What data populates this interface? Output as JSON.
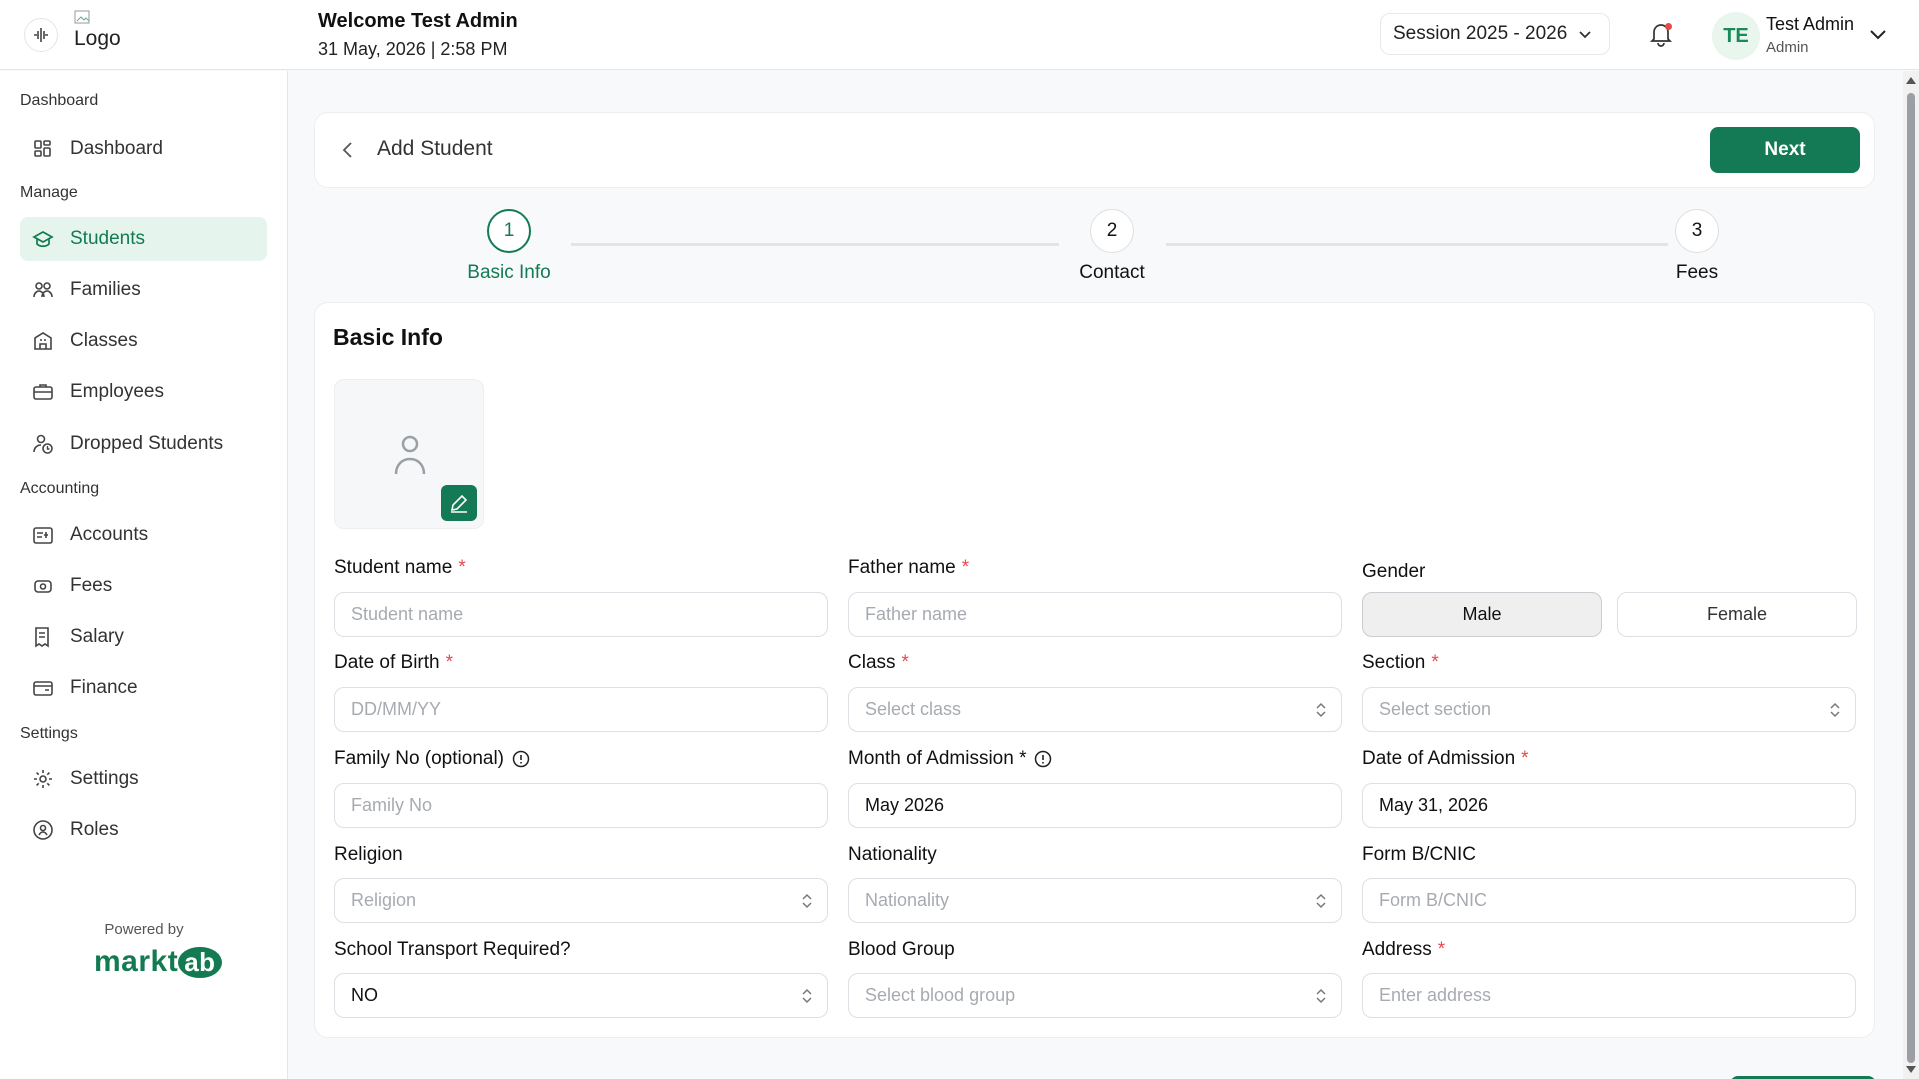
{
  "header": {
    "logo_alt": "Logo",
    "welcome": "Welcome Test Admin",
    "datetime": "31 May, 2026 | 2:58 PM",
    "session": "Session 2025 - 2026",
    "user_initials": "TE",
    "user_name": "Test Admin",
    "user_role": "Admin"
  },
  "sidebar": {
    "sections": [
      "Dashboard",
      "Manage",
      "Accounting",
      "Settings"
    ],
    "items": [
      {
        "label": "Dashboard",
        "icon": "grid-icon"
      },
      {
        "label": "Students",
        "icon": "graduation-cap-icon",
        "active": true
      },
      {
        "label": "Families",
        "icon": "users-icon"
      },
      {
        "label": "Classes",
        "icon": "building-icon"
      },
      {
        "label": "Employees",
        "icon": "briefcase-icon"
      },
      {
        "label": "Dropped Students",
        "icon": "user-clock-icon"
      },
      {
        "label": "Accounts",
        "icon": "accounts-icon"
      },
      {
        "label": "Fees",
        "icon": "money-icon"
      },
      {
        "label": "Salary",
        "icon": "receipt-icon"
      },
      {
        "label": "Finance",
        "icon": "wallet-icon"
      },
      {
        "label": "Settings",
        "icon": "gear-icon"
      },
      {
        "label": "Roles",
        "icon": "shield-user-icon"
      }
    ],
    "powered_by": "Powered by",
    "brand_left": "markt",
    "brand_right": "ab"
  },
  "page": {
    "title": "Add Student",
    "next_label": "Next"
  },
  "steps": [
    {
      "number": "1",
      "label": "Basic Info",
      "active": true
    },
    {
      "number": "2",
      "label": "Contact"
    },
    {
      "number": "3",
      "label": "Fees"
    }
  ],
  "form": {
    "section_title": "Basic Info",
    "student_name": {
      "label": "Student name",
      "placeholder": "Student name"
    },
    "father_name": {
      "label": "Father name",
      "placeholder": "Father name"
    },
    "gender": {
      "label": "Gender",
      "options": [
        "Male",
        "Female"
      ],
      "selected": "Male"
    },
    "dob": {
      "label": "Date of Birth",
      "placeholder": "DD/MM/YY"
    },
    "class": {
      "label": "Class",
      "placeholder": "Select class"
    },
    "section": {
      "label": "Section",
      "placeholder": "Select section"
    },
    "family_no": {
      "label": "Family No (optional)",
      "placeholder": "Family No"
    },
    "month_admission": {
      "label": "Month of Admission *",
      "value": "May 2026"
    },
    "date_admission": {
      "label": "Date of Admission",
      "value": "May 31, 2026"
    },
    "religion": {
      "label": "Religion",
      "placeholder": "Religion"
    },
    "nationality": {
      "label": "Nationality",
      "placeholder": "Nationality"
    },
    "form_b": {
      "label": "Form B/CNIC",
      "placeholder": "Form B/CNIC"
    },
    "transport": {
      "label": "School Transport Required?",
      "value": "NO"
    },
    "blood_group": {
      "label": "Blood Group",
      "placeholder": "Select blood group"
    },
    "address": {
      "label": "Address",
      "placeholder": "Enter address"
    }
  },
  "colors": {
    "primary": "#147a55",
    "active_bg": "#e5f4ec",
    "required": "#e5484d"
  }
}
